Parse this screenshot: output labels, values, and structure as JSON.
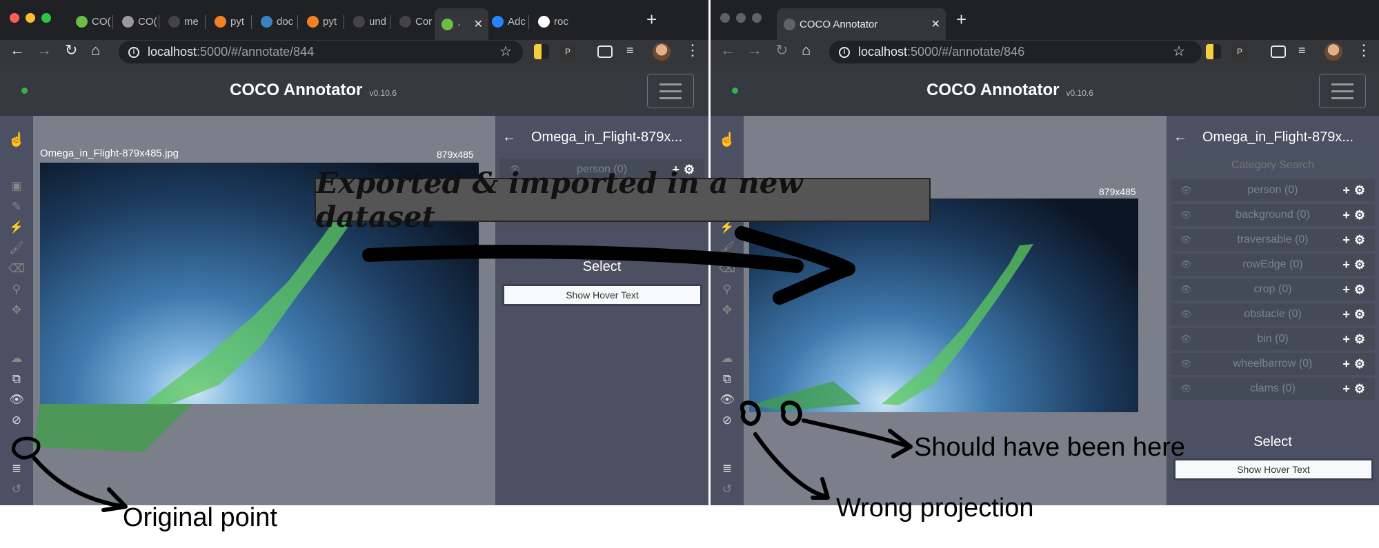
{
  "left_window": {
    "tabs": [
      {
        "label": "CO(",
        "icon": "globe-icon"
      },
      {
        "label": "CO(",
        "icon": "coco-icon"
      },
      {
        "label": "me",
        "icon": "github-icon"
      },
      {
        "label": "pyt",
        "icon": "stackoverflow-icon"
      },
      {
        "label": "doc",
        "icon": "docs-icon"
      },
      {
        "label": "pyt",
        "icon": "stackoverflow-icon"
      },
      {
        "label": "und",
        "icon": "github-icon"
      },
      {
        "label": "Cor",
        "icon": "github-icon"
      },
      {
        "label": "·",
        "icon": "globe-icon"
      },
      {
        "label": "Adc",
        "icon": "confluence-icon"
      },
      {
        "label": "roc",
        "icon": "google-icon"
      }
    ],
    "url_host": "localhost",
    "url_path": ":5000/#/annotate/844",
    "app_title": "COCO Annotator",
    "version": "v0.10.6",
    "image_filename": "Omega_in_Flight-879x485.jpg",
    "image_dims": "879x485",
    "panel_title": "Omega_in_Flight-879x...",
    "categories": [
      "person (0)"
    ],
    "select_label": "Select",
    "hover_button": "Show Hover Text"
  },
  "right_window": {
    "tab_label": "COCO Annotator",
    "url_host": "localhost",
    "url_path": ":5000/#/annotate/846",
    "app_title": "COCO Annotator",
    "version": "v0.10.6",
    "image_dims": "879x485",
    "panel_title": "Omega_in_Flight-879x...",
    "search_placeholder": "Category Search",
    "categories": [
      "person (0)",
      "background (0)",
      "traversable (0)",
      "rowEdge (0)",
      "crop (0)",
      "obstacle (0)",
      "bin (0)",
      "wheelbarrow (0)",
      "clams (0)"
    ],
    "select_label": "Select",
    "hover_button": "Show Hover Text"
  },
  "annotations": {
    "banner": "Exported & imported in a new dataset",
    "original_point": "Original point",
    "wrong_projection": "Wrong projection",
    "should_have_been": "Should have been here"
  },
  "colors": {
    "chrome_dark": "#202124",
    "chrome_toolbar": "#35363a",
    "appbar": "#343a40",
    "panel": "#4b5162",
    "canvas": "#7a7f89",
    "mask_green": "#5cc85c"
  }
}
